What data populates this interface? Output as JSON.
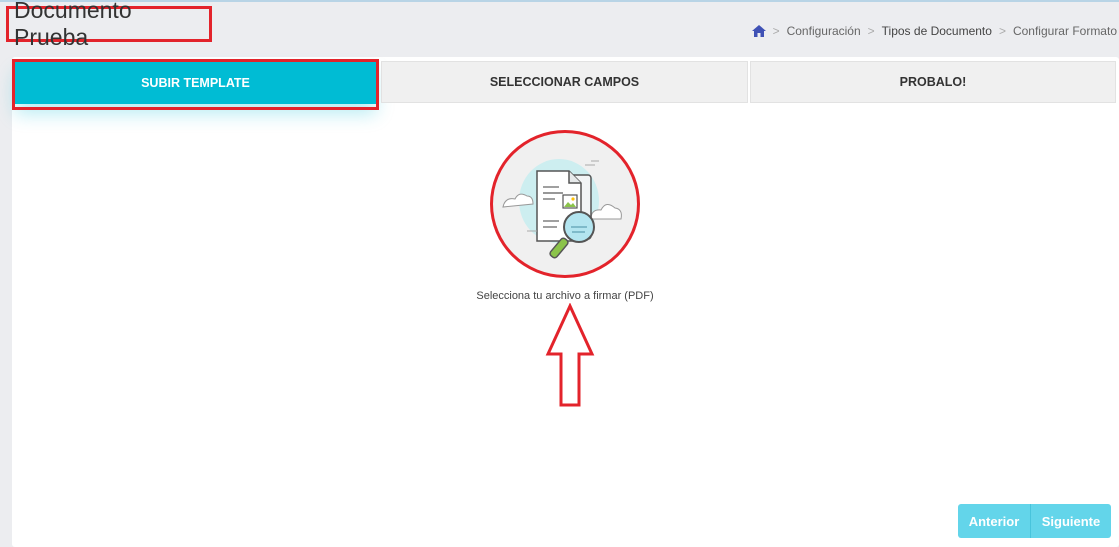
{
  "header": {
    "title": "Documento Prueba",
    "breadcrumb": [
      "Configuración",
      "Tipos de Documento",
      "Configurar Formato"
    ],
    "home_icon": "home-icon"
  },
  "tabs": [
    {
      "label": "SUBIR TEMPLATE",
      "active": true
    },
    {
      "label": "SELECCIONAR CAMPOS",
      "active": false
    },
    {
      "label": "PROBALO!",
      "active": false
    }
  ],
  "upload": {
    "caption": "Selecciona tu archivo a firmar (PDF)",
    "icon": "document-search-icon"
  },
  "buttons": {
    "prev": "Anterior",
    "next": "Siguiente"
  },
  "colors": {
    "accent": "#00bcd4",
    "button": "#63d5ea",
    "highlight": "#e3232b"
  }
}
